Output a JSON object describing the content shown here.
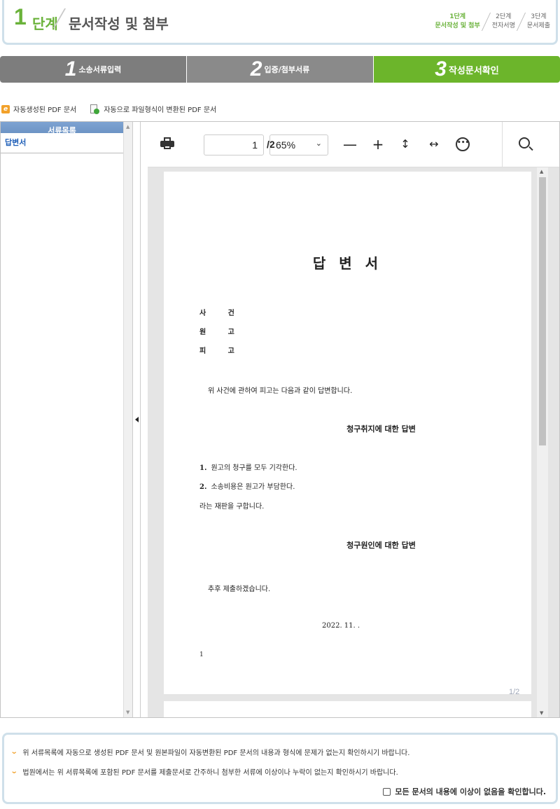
{
  "header": {
    "step_number": "1",
    "step_word": "단계",
    "title": "문서작성 및 첨부",
    "steps": [
      {
        "line1": "1단계",
        "line2": "문서작성 및 첨부"
      },
      {
        "line1": "2단계",
        "line2": "전자서명"
      },
      {
        "line1": "3단계",
        "line2": "문서제출"
      }
    ],
    "active_color": "#6ab23a"
  },
  "progress": {
    "tabs": [
      {
        "num": "1",
        "label": "소송서류입력"
      },
      {
        "num": "2",
        "label": "입증/첨부서류"
      },
      {
        "num": "3",
        "label": "작성문서확인"
      }
    ],
    "active_index": 2,
    "active_color": "#6cb52b",
    "inactive_color": "#8a8a8a"
  },
  "legend": {
    "auto_pdf_icon": "e-doc-icon",
    "auto_pdf": "자동생성된 PDF 문서",
    "converted_pdf_icon": "file-convert-icon",
    "converted_pdf": "자동으로 파일형식이 변환된 PDF 문서"
  },
  "sidebar": {
    "header": "서류목록",
    "items": [
      "답변서"
    ]
  },
  "viewer": {
    "page_current": "1",
    "page_total": "/2",
    "zoom": "65%",
    "page_indicator": "1/2"
  },
  "document": {
    "title": "답 변 서",
    "fields": [
      "사 건",
      "원 고",
      "피 고"
    ],
    "intro": "위 사건에 관하여 피고는 다음과 같이 답변합니다.",
    "section1_title": "청구취지에 대한 답변",
    "section1_items": [
      {
        "num": "1.",
        "text": "원고의 청구를 모두 기각한다."
      },
      {
        "num": "2.",
        "text": "소송비용은 원고가 부담한다."
      }
    ],
    "section1_tail": "라는 재판을 구합니다.",
    "section2_title": "청구원인에 대한 답변",
    "section2_text": "추후 제출하겠습니다.",
    "date": "2022.  11.   .",
    "footnote": "1"
  },
  "confirm": {
    "line1": "위 서류목록에 자동으로 생성된 PDF 문서 및 원본파일이 자동변환된 PDF 문서의 내용과 형식에 문제가 없는지 확인하시기 바랍니다.",
    "line2": "법원에서는 위 서류목록에 포함된 PDF 문서를 제출문서로 간주하니 첨부한 서류에 이상이나 누락이 없는지 확인하시기 바랍니다.",
    "checkbox_label": "모든 문서의 내용에 이상이 없음을 확인합니다.",
    "checked": false
  }
}
